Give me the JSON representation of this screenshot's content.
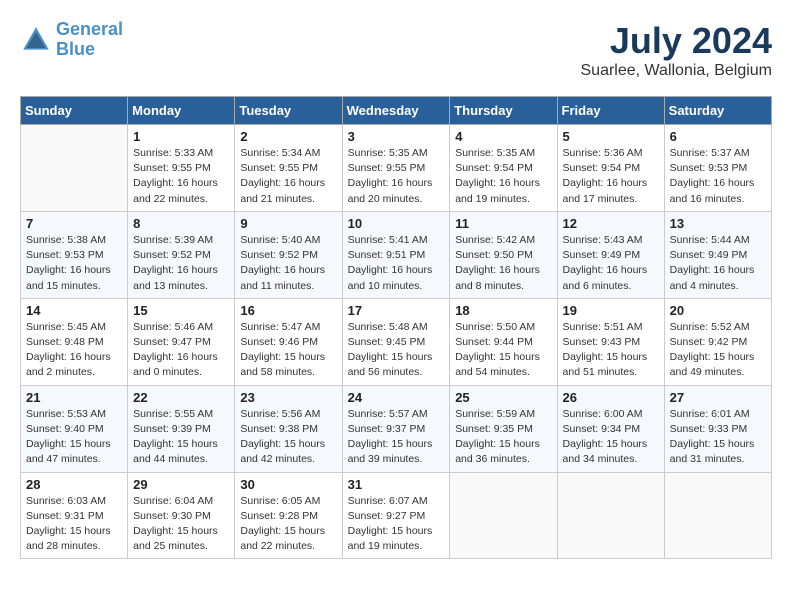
{
  "header": {
    "logo_line1": "General",
    "logo_line2": "Blue",
    "month": "July 2024",
    "location": "Suarlee, Wallonia, Belgium"
  },
  "days_of_week": [
    "Sunday",
    "Monday",
    "Tuesday",
    "Wednesday",
    "Thursday",
    "Friday",
    "Saturday"
  ],
  "weeks": [
    [
      {
        "day": "",
        "info": ""
      },
      {
        "day": "1",
        "info": "Sunrise: 5:33 AM\nSunset: 9:55 PM\nDaylight: 16 hours\nand 22 minutes."
      },
      {
        "day": "2",
        "info": "Sunrise: 5:34 AM\nSunset: 9:55 PM\nDaylight: 16 hours\nand 21 minutes."
      },
      {
        "day": "3",
        "info": "Sunrise: 5:35 AM\nSunset: 9:55 PM\nDaylight: 16 hours\nand 20 minutes."
      },
      {
        "day": "4",
        "info": "Sunrise: 5:35 AM\nSunset: 9:54 PM\nDaylight: 16 hours\nand 19 minutes."
      },
      {
        "day": "5",
        "info": "Sunrise: 5:36 AM\nSunset: 9:54 PM\nDaylight: 16 hours\nand 17 minutes."
      },
      {
        "day": "6",
        "info": "Sunrise: 5:37 AM\nSunset: 9:53 PM\nDaylight: 16 hours\nand 16 minutes."
      }
    ],
    [
      {
        "day": "7",
        "info": "Sunrise: 5:38 AM\nSunset: 9:53 PM\nDaylight: 16 hours\nand 15 minutes."
      },
      {
        "day": "8",
        "info": "Sunrise: 5:39 AM\nSunset: 9:52 PM\nDaylight: 16 hours\nand 13 minutes."
      },
      {
        "day": "9",
        "info": "Sunrise: 5:40 AM\nSunset: 9:52 PM\nDaylight: 16 hours\nand 11 minutes."
      },
      {
        "day": "10",
        "info": "Sunrise: 5:41 AM\nSunset: 9:51 PM\nDaylight: 16 hours\nand 10 minutes."
      },
      {
        "day": "11",
        "info": "Sunrise: 5:42 AM\nSunset: 9:50 PM\nDaylight: 16 hours\nand 8 minutes."
      },
      {
        "day": "12",
        "info": "Sunrise: 5:43 AM\nSunset: 9:49 PM\nDaylight: 16 hours\nand 6 minutes."
      },
      {
        "day": "13",
        "info": "Sunrise: 5:44 AM\nSunset: 9:49 PM\nDaylight: 16 hours\nand 4 minutes."
      }
    ],
    [
      {
        "day": "14",
        "info": "Sunrise: 5:45 AM\nSunset: 9:48 PM\nDaylight: 16 hours\nand 2 minutes."
      },
      {
        "day": "15",
        "info": "Sunrise: 5:46 AM\nSunset: 9:47 PM\nDaylight: 16 hours\nand 0 minutes."
      },
      {
        "day": "16",
        "info": "Sunrise: 5:47 AM\nSunset: 9:46 PM\nDaylight: 15 hours\nand 58 minutes."
      },
      {
        "day": "17",
        "info": "Sunrise: 5:48 AM\nSunset: 9:45 PM\nDaylight: 15 hours\nand 56 minutes."
      },
      {
        "day": "18",
        "info": "Sunrise: 5:50 AM\nSunset: 9:44 PM\nDaylight: 15 hours\nand 54 minutes."
      },
      {
        "day": "19",
        "info": "Sunrise: 5:51 AM\nSunset: 9:43 PM\nDaylight: 15 hours\nand 51 minutes."
      },
      {
        "day": "20",
        "info": "Sunrise: 5:52 AM\nSunset: 9:42 PM\nDaylight: 15 hours\nand 49 minutes."
      }
    ],
    [
      {
        "day": "21",
        "info": "Sunrise: 5:53 AM\nSunset: 9:40 PM\nDaylight: 15 hours\nand 47 minutes."
      },
      {
        "day": "22",
        "info": "Sunrise: 5:55 AM\nSunset: 9:39 PM\nDaylight: 15 hours\nand 44 minutes."
      },
      {
        "day": "23",
        "info": "Sunrise: 5:56 AM\nSunset: 9:38 PM\nDaylight: 15 hours\nand 42 minutes."
      },
      {
        "day": "24",
        "info": "Sunrise: 5:57 AM\nSunset: 9:37 PM\nDaylight: 15 hours\nand 39 minutes."
      },
      {
        "day": "25",
        "info": "Sunrise: 5:59 AM\nSunset: 9:35 PM\nDaylight: 15 hours\nand 36 minutes."
      },
      {
        "day": "26",
        "info": "Sunrise: 6:00 AM\nSunset: 9:34 PM\nDaylight: 15 hours\nand 34 minutes."
      },
      {
        "day": "27",
        "info": "Sunrise: 6:01 AM\nSunset: 9:33 PM\nDaylight: 15 hours\nand 31 minutes."
      }
    ],
    [
      {
        "day": "28",
        "info": "Sunrise: 6:03 AM\nSunset: 9:31 PM\nDaylight: 15 hours\nand 28 minutes."
      },
      {
        "day": "29",
        "info": "Sunrise: 6:04 AM\nSunset: 9:30 PM\nDaylight: 15 hours\nand 25 minutes."
      },
      {
        "day": "30",
        "info": "Sunrise: 6:05 AM\nSunset: 9:28 PM\nDaylight: 15 hours\nand 22 minutes."
      },
      {
        "day": "31",
        "info": "Sunrise: 6:07 AM\nSunset: 9:27 PM\nDaylight: 15 hours\nand 19 minutes."
      },
      {
        "day": "",
        "info": ""
      },
      {
        "day": "",
        "info": ""
      },
      {
        "day": "",
        "info": ""
      }
    ]
  ]
}
